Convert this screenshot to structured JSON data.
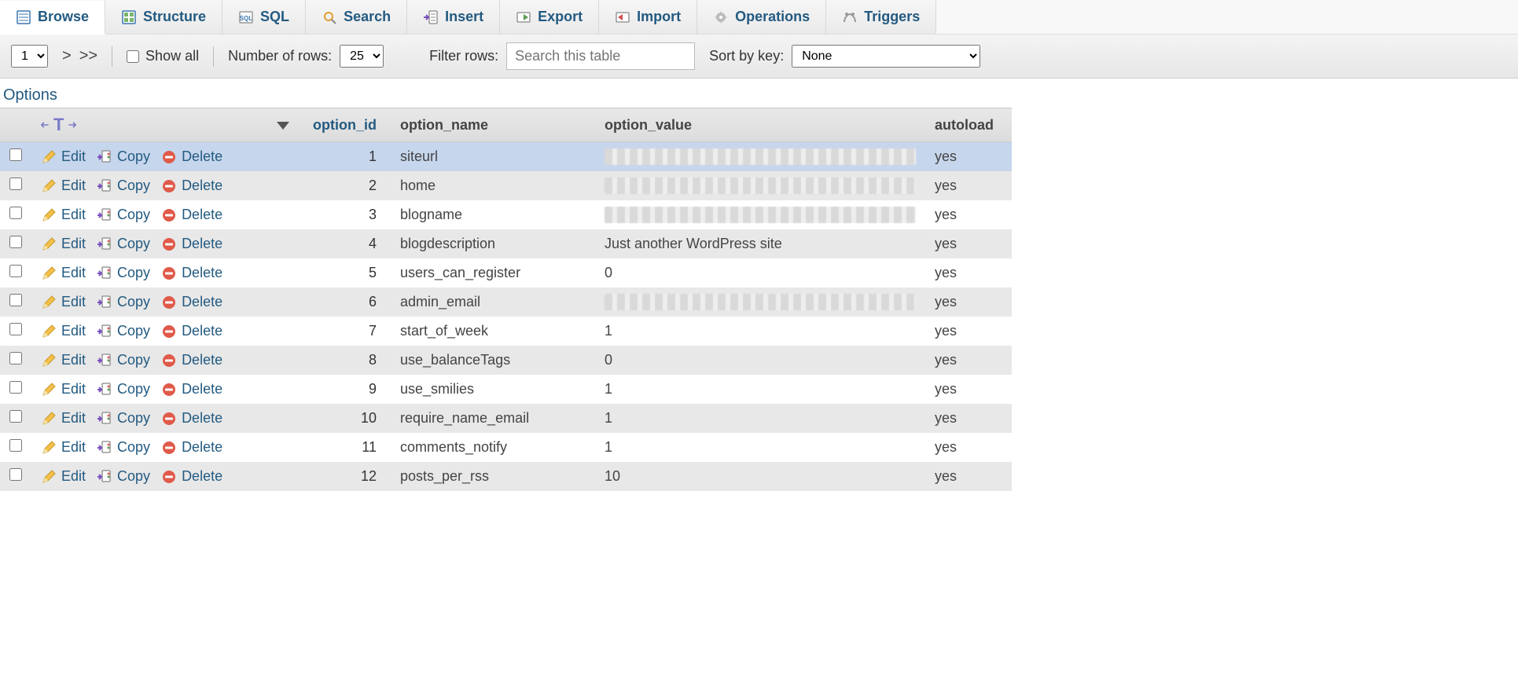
{
  "tabs": [
    {
      "label": "Browse"
    },
    {
      "label": "Structure"
    },
    {
      "label": "SQL"
    },
    {
      "label": "Search"
    },
    {
      "label": "Insert"
    },
    {
      "label": "Export"
    },
    {
      "label": "Import"
    },
    {
      "label": "Operations"
    },
    {
      "label": "Triggers"
    }
  ],
  "toolbar": {
    "page_select": "1",
    "next": ">",
    "last": ">>",
    "show_all": "Show all",
    "num_rows_label": "Number of rows:",
    "num_rows_value": "25",
    "filter_label": "Filter rows:",
    "filter_placeholder": "Search this table",
    "sort_label": "Sort by key:",
    "sort_value": "None"
  },
  "options_label": "Options",
  "columns": {
    "option_id": "option_id",
    "option_name": "option_name",
    "option_value": "option_value",
    "autoload": "autoload"
  },
  "row_action_labels": {
    "edit": "Edit",
    "copy": "Copy",
    "delete": "Delete"
  },
  "rows": [
    {
      "id": 1,
      "name": "siteurl",
      "value": "",
      "blurred": true,
      "autoload": "yes",
      "selected": true
    },
    {
      "id": 2,
      "name": "home",
      "value": "",
      "blurred": true,
      "autoload": "yes"
    },
    {
      "id": 3,
      "name": "blogname",
      "value": "",
      "blurred": true,
      "autoload": "yes"
    },
    {
      "id": 4,
      "name": "blogdescription",
      "value": "Just another WordPress site",
      "blurred": false,
      "autoload": "yes"
    },
    {
      "id": 5,
      "name": "users_can_register",
      "value": "0",
      "blurred": false,
      "autoload": "yes"
    },
    {
      "id": 6,
      "name": "admin_email",
      "value": "",
      "blurred": true,
      "autoload": "yes"
    },
    {
      "id": 7,
      "name": "start_of_week",
      "value": "1",
      "blurred": false,
      "autoload": "yes"
    },
    {
      "id": 8,
      "name": "use_balanceTags",
      "value": "0",
      "blurred": false,
      "autoload": "yes"
    },
    {
      "id": 9,
      "name": "use_smilies",
      "value": "1",
      "blurred": false,
      "autoload": "yes"
    },
    {
      "id": 10,
      "name": "require_name_email",
      "value": "1",
      "blurred": false,
      "autoload": "yes"
    },
    {
      "id": 11,
      "name": "comments_notify",
      "value": "1",
      "blurred": false,
      "autoload": "yes"
    },
    {
      "id": 12,
      "name": "posts_per_rss",
      "value": "10",
      "blurred": false,
      "autoload": "yes"
    }
  ]
}
